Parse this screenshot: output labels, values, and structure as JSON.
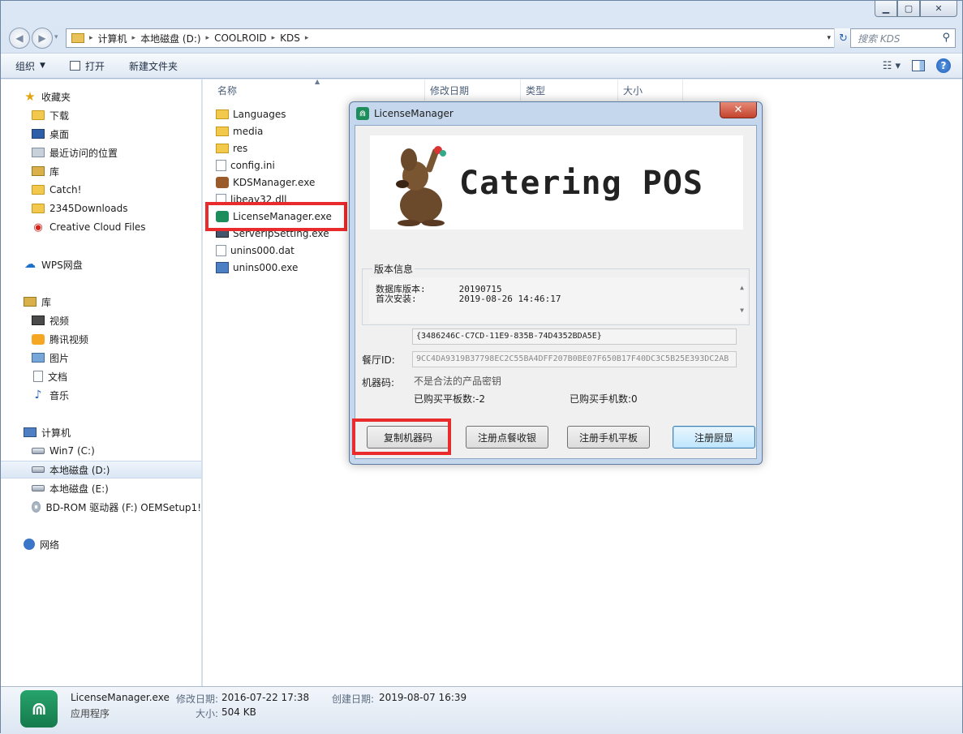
{
  "window": {
    "address": [
      "计算机",
      "本地磁盘 (D:)",
      "COOLROID",
      "KDS"
    ],
    "search_placeholder": "搜索 KDS"
  },
  "toolbar": {
    "organize": "组织",
    "open": "打开",
    "new_folder": "新建文件夹"
  },
  "nav": {
    "favorites": "收藏夹",
    "downloads": "下载",
    "desktop": "桌面",
    "recent": "最近访问的位置",
    "lib_fav": "库",
    "catch": "Catch!",
    "downloads2345": "2345Downloads",
    "creative_cloud": "Creative Cloud Files",
    "wps": "WPS网盘",
    "libraries": "库",
    "videos": "视频",
    "tencent": "腾讯视频",
    "pictures": "图片",
    "documents": "文档",
    "music": "音乐",
    "computer": "计算机",
    "drive_c": "Win7 (C:)",
    "drive_d": "本地磁盘 (D:)",
    "drive_e": "本地磁盘 (E:)",
    "drive_f": "BD-ROM 驱动器 (F:) OEMSetup1!",
    "network": "网络"
  },
  "columns": {
    "name": "名称",
    "modified": "修改日期",
    "type": "类型",
    "size": "大小"
  },
  "files": [
    "Languages",
    "media",
    "res",
    "config.ini",
    "KDSManager.exe",
    "libeay32.dll",
    "LicenseManager.exe",
    "ServerIpSetting.exe",
    "unins000.dat",
    "unins000.exe"
  ],
  "details": {
    "name": "LicenseManager.exe",
    "type": "应用程序",
    "modified_label": "修改日期:",
    "modified_value": "2016-07-22 17:38",
    "created_label": "创建日期:",
    "created_value": "2019-08-07 16:39",
    "size_label": "大小:",
    "size_value": "504 KB"
  },
  "dialog": {
    "title": "LicenseManager",
    "banner_title": "Catering POS",
    "version_group": "版本信息",
    "db_version_label": "数据库版本:",
    "db_version_value": "20190715",
    "first_install_label": "首次安装:",
    "first_install_value": "2019-08-26 14:46:17",
    "restaurant_id_label": "餐厅ID:",
    "restaurant_id_value": "{3486246C-C7CD-11E9-835B-74D4352BDA5E}",
    "machine_code_label": "机器码:",
    "machine_code_value": "9CC4DA9319B37798EC2C55BA4DFF207B0BE07F650B17F40DC3C5B25E393DC2AB",
    "invalid_note": "不是合法的产品密钥",
    "tablets_bought": "已购买平板数:-2",
    "phones_bought": "已购买手机数:0",
    "btn_copy": "复制机器码",
    "btn_register_pos": "注册点餐收银",
    "btn_register_mobile": "注册手机平板",
    "btn_register_kitchen": "注册厨显"
  }
}
